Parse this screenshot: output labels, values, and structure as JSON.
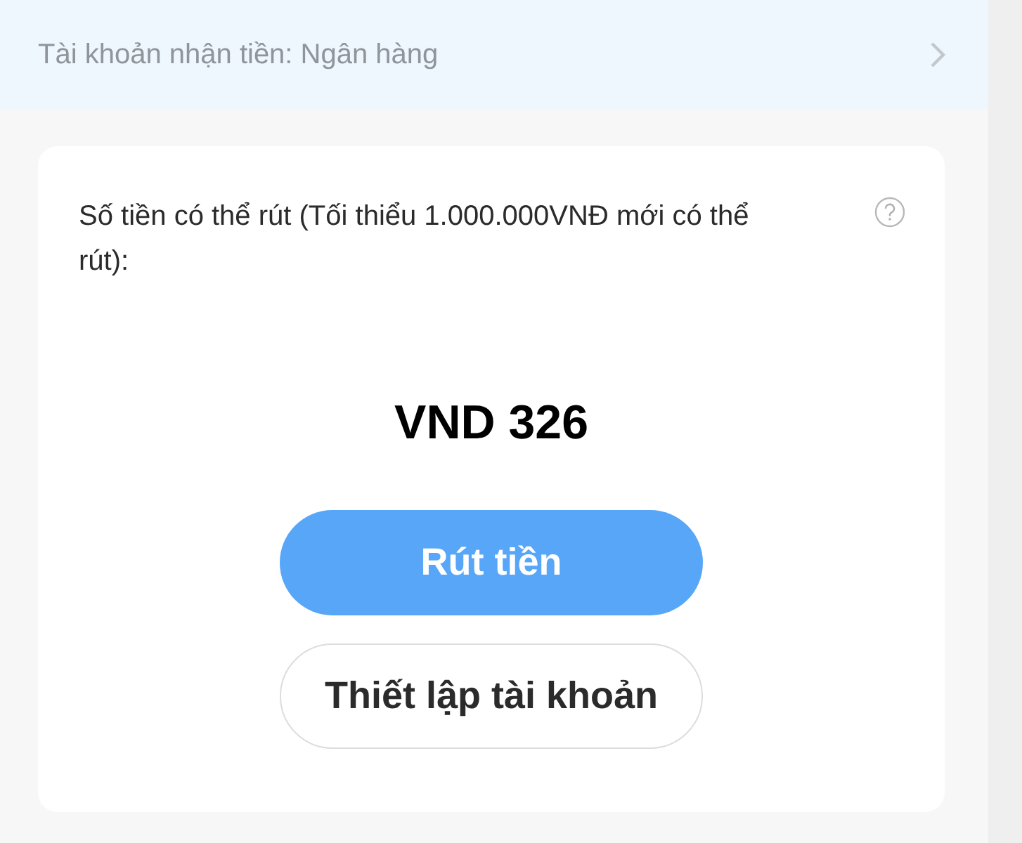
{
  "account_row": {
    "label": "Tài khoản nhận tiền: Ngân hàng"
  },
  "balance_card": {
    "caption": "Số tiền có thể rút (Tối thiểu 1.000.000VNĐ mới có thể rút):",
    "amount": "VND 326"
  },
  "buttons": [
    {
      "label": "Rút tiền",
      "kind": "primary"
    },
    {
      "label": "Thiết lập tài khoản",
      "kind": "outline"
    }
  ]
}
